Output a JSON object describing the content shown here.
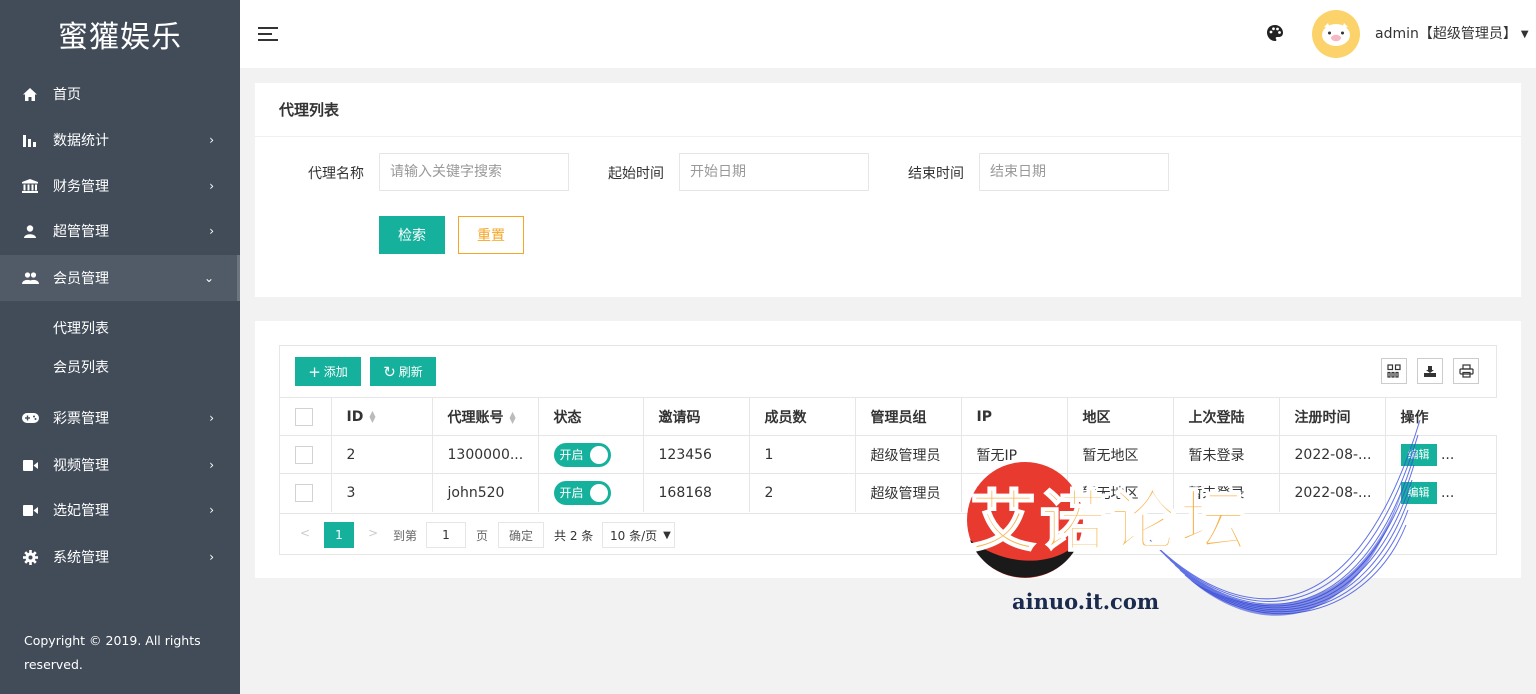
{
  "brand": "蜜獾娱乐",
  "sidebar": {
    "items": [
      {
        "label": "首页",
        "icon": "home-icon",
        "has_arrow": false
      },
      {
        "label": "数据统计",
        "icon": "bar-chart-icon",
        "has_arrow": true
      },
      {
        "label": "财务管理",
        "icon": "bank-icon",
        "has_arrow": true
      },
      {
        "label": "超管管理",
        "icon": "user-icon",
        "has_arrow": true
      },
      {
        "label": "会员管理",
        "icon": "users-icon",
        "has_arrow": true,
        "expanded": true
      },
      {
        "label": "彩票管理",
        "icon": "gamepad-icon",
        "has_arrow": true
      },
      {
        "label": "视频管理",
        "icon": "video-icon",
        "has_arrow": true
      },
      {
        "label": "选妃管理",
        "icon": "video-icon",
        "has_arrow": true
      },
      {
        "label": "系统管理",
        "icon": "gear-icon",
        "has_arrow": true
      }
    ],
    "sub_items": [
      "代理列表",
      "会员列表"
    ],
    "copyright": "Copyright © 2019. All rights reserved."
  },
  "header": {
    "user": "admin【超级管理员】"
  },
  "search": {
    "title": "代理列表",
    "name_label": "代理名称",
    "name_placeholder": "请输入关键字搜索",
    "start_label": "起始时间",
    "start_placeholder": "开始日期",
    "end_label": "结束时间",
    "end_placeholder": "结束日期",
    "search_button": "检索",
    "reset_button": "重置"
  },
  "table": {
    "add_button": "添加",
    "refresh_button": "刷新",
    "columns": [
      "",
      "ID",
      "代理账号",
      "状态",
      "邀请码",
      "成员数",
      "管理员组",
      "IP",
      "地区",
      "上次登陆",
      "注册时间",
      "操作"
    ],
    "rows": [
      {
        "id": "2",
        "account": "1300000...",
        "status": "开启",
        "invite": "123456",
        "members": "1",
        "group": "超级管理员",
        "ip": "暂无IP",
        "region": "暂无地区",
        "last_login": "暂未登录",
        "reg_time": "2022-08-...",
        "edit": "编辑",
        "more": "..."
      },
      {
        "id": "3",
        "account": "john520",
        "status": "开启",
        "invite": "168168",
        "members": "2",
        "group": "超级管理员",
        "ip": "暂无IP",
        "region": "暂无地区",
        "last_login": "暂未登录",
        "reg_time": "2022-08-...",
        "edit": "编辑",
        "more": "..."
      }
    ]
  },
  "pagination": {
    "prev": "<",
    "current": "1",
    "next": ">",
    "goto_label": "到第",
    "goto_value": "1",
    "page_unit": "页",
    "confirm": "确定",
    "total": "共 2 条",
    "page_size": "10 条/页"
  },
  "watermark": {
    "text": "艾诺论坛",
    "url": "ainuo.it.com"
  },
  "colors": {
    "sidebar_bg": "#424c59",
    "accent": "#16b19c",
    "reset": "#f5a623"
  }
}
